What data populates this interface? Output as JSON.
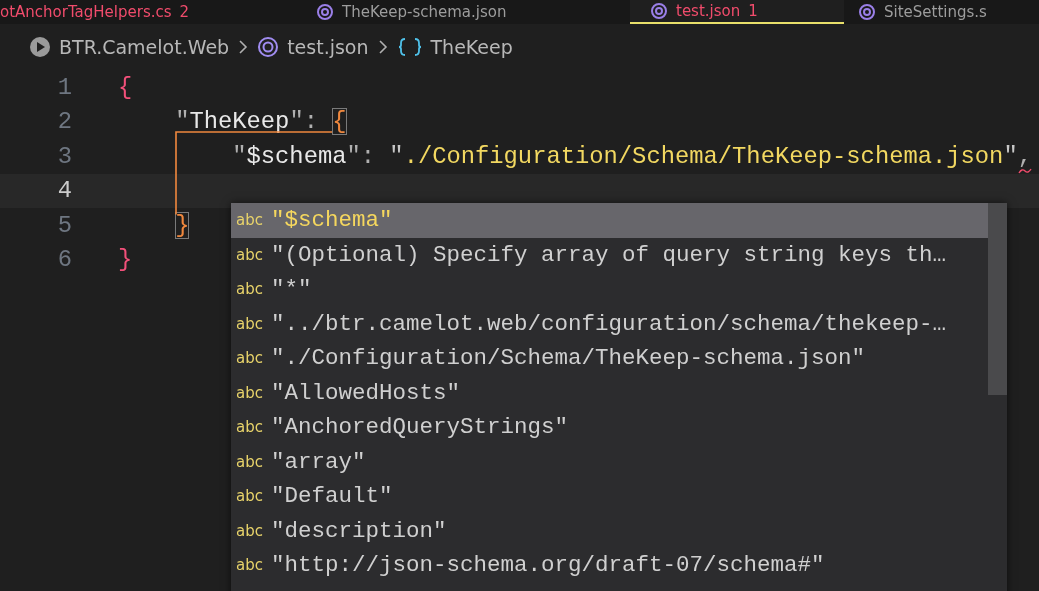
{
  "tabs": [
    {
      "label": "otAnchorTagHelpers.cs",
      "badge": "2",
      "error": true,
      "selected": false
    },
    {
      "label": "TheKeep-schema.json",
      "error": false,
      "selected": false
    },
    {
      "label": "test.json",
      "badge": "1",
      "error": true,
      "selected": true
    },
    {
      "label": "SiteSettings.s",
      "error": false,
      "selected": false
    }
  ],
  "breadcrumb": [
    "BTR.Camelot.Web",
    "test.json",
    "TheKeep"
  ],
  "editor": {
    "lines": [
      {
        "number": "1",
        "current": false,
        "tokens": [
          {
            "kind": "brace",
            "color": "#f2507a",
            "text": "{"
          }
        ]
      },
      {
        "number": "2",
        "current": false,
        "tokens": [
          {
            "kind": "key",
            "text": "    \"TheKeep\""
          },
          {
            "kind": "punct",
            "text": ": "
          },
          {
            "kind": "brace",
            "color": "#f0883e",
            "match": true,
            "text": "{"
          }
        ]
      },
      {
        "number": "3",
        "current": false,
        "tokens": [
          {
            "kind": "key",
            "text": "        \"$schema\""
          },
          {
            "kind": "punct",
            "text": ": "
          },
          {
            "kind": "string",
            "text": "\"./Configuration/Schema/TheKeep-schema.json\""
          },
          {
            "kind": "punct",
            "error": true,
            "text": ","
          }
        ]
      },
      {
        "number": "4",
        "current": true
      },
      {
        "number": "5",
        "current": false,
        "tokens": [
          {
            "kind": "brace",
            "color": "#f0883e",
            "match": true,
            "text": "    }"
          }
        ]
      },
      {
        "number": "6",
        "current": false,
        "tokens": [
          {
            "kind": "brace",
            "color": "#f2507a",
            "text": "}"
          }
        ]
      }
    ]
  },
  "suggest": {
    "items": [
      {
        "icon": "abc",
        "label": "\"$schema\"",
        "selected": true
      },
      {
        "icon": "abc",
        "label": "\"(Optional) Specify array of query string keys th…",
        "selected": false
      },
      {
        "icon": "abc",
        "label": "\"*\"",
        "selected": false
      },
      {
        "icon": "abc",
        "label": "\"../btr.camelot.web/configuration/schema/thekeep-…",
        "selected": false
      },
      {
        "icon": "abc",
        "label": "\"./Configuration/Schema/TheKeep-schema.json\"",
        "selected": false
      },
      {
        "icon": "abc",
        "label": "\"AllowedHosts\"",
        "selected": false
      },
      {
        "icon": "abc",
        "label": "\"AnchoredQueryStrings\"",
        "selected": false
      },
      {
        "icon": "abc",
        "label": "\"array\"",
        "selected": false
      },
      {
        "icon": "abc",
        "label": "\"Default\"",
        "selected": false
      },
      {
        "icon": "abc",
        "label": "\"description\"",
        "selected": false
      },
      {
        "icon": "abc",
        "label": "\"http://json-schema.org/draft-07/schema#\"",
        "selected": false
      }
    ]
  }
}
